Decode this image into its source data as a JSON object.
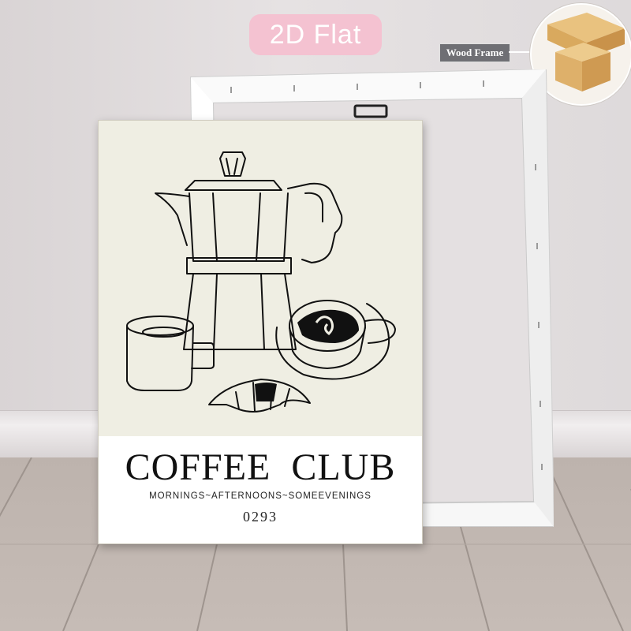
{
  "badge": {
    "label": "2D Flat"
  },
  "frame_callout": {
    "label": "Wood Frame"
  },
  "poster": {
    "title": "COFFEE  CLUB",
    "subtitle": "MORNINGS~AFTERNOONS~SOMEEVENINGS",
    "number": "0293",
    "illustration": [
      "moka-pot",
      "coffee-mug",
      "espresso-cup-saucer",
      "croissant"
    ]
  },
  "colors": {
    "badge_bg": "#f4c2d1",
    "poster_bg": "#efeee3",
    "caption_bg": "#ffffff",
    "ink": "#111111",
    "wall": "#e2dedf",
    "floor": "#c2b8b2"
  }
}
